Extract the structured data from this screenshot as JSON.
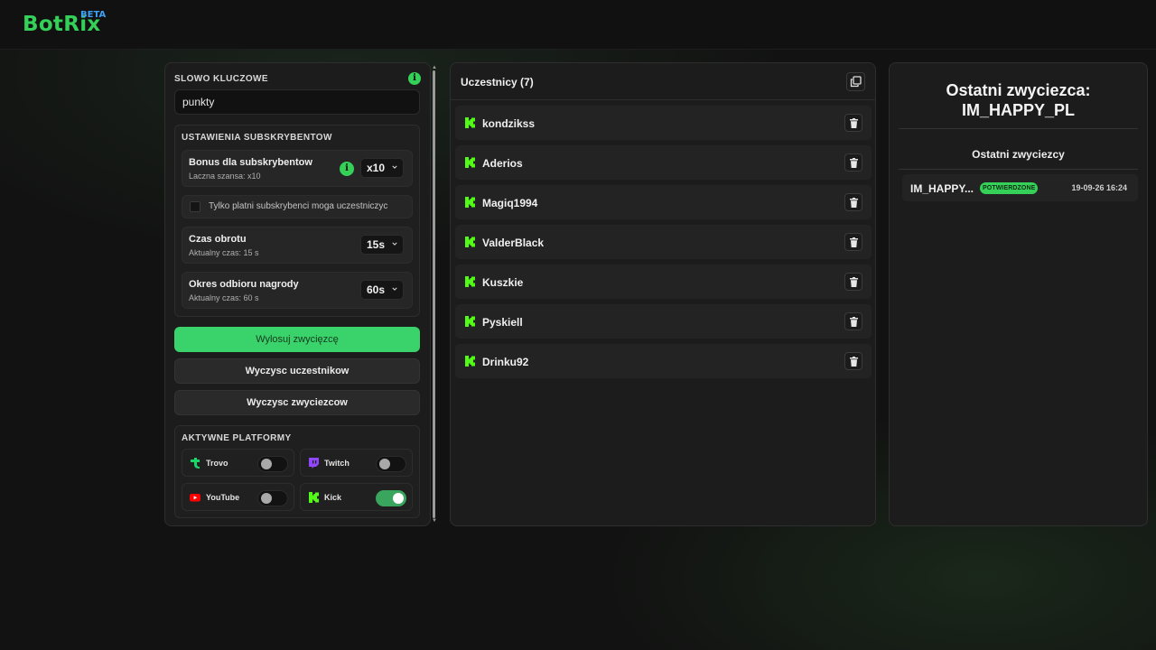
{
  "brand": {
    "name": "BotRix",
    "badge": "BETA"
  },
  "settings": {
    "keyword_label": "SLOWO KLUCZOWE",
    "keyword_value": "punkty",
    "info_glyph": "i",
    "subscriber_section_label": "USTAWIENIA SUBSKRYBENTOW",
    "bonus": {
      "title": "Bonus dla subskrybentow",
      "subtitle": "Laczna szansa: x10",
      "value": "x10"
    },
    "paid_only_label": "Tylko platni subskrybenci moga uczestniczyc",
    "paid_only_checked": false,
    "spin_time": {
      "title": "Czas obrotu",
      "subtitle": "Aktualny czas: 15 s",
      "value": "15s"
    },
    "claim_period": {
      "title": "Okres odbioru nagrody",
      "subtitle": "Aktualny czas: 60 s",
      "value": "60s"
    }
  },
  "actions": {
    "draw_winner": "Wylosuj zwycięzcę",
    "clear_participants": "Wyczysc uczestnikow",
    "clear_winners": "Wyczysc zwyciezcow"
  },
  "platforms": {
    "label": "AKTYWNE PLATFORMY",
    "items": [
      {
        "name": "Trovo",
        "enabled": false,
        "icon": "trovo-icon",
        "color": "#19d66b"
      },
      {
        "name": "Twitch",
        "enabled": false,
        "icon": "twitch-icon",
        "color": "#9146ff"
      },
      {
        "name": "YouTube",
        "enabled": false,
        "icon": "youtube-icon",
        "color": "#ff0000"
      },
      {
        "name": "Kick",
        "enabled": true,
        "icon": "kick-icon",
        "color": "#53fc18"
      }
    ]
  },
  "participants": {
    "title": "Uczestnicy (7)",
    "items": [
      "kondzikss",
      "Aderios",
      "Magiq1994",
      "ValderBlack",
      "Kuszkie",
      "Pyskiell",
      "Drinku92"
    ]
  },
  "winners": {
    "last_winner_title": "Ostatni zwyciezca:",
    "last_winner_name": "IM_HAPPY_PL",
    "recent_title": "Ostatni zwyciezcy",
    "rows": [
      {
        "name": "IM_HAPPY...",
        "status": "POTWIERDZONE",
        "date": "19-09-26 16:24"
      }
    ]
  },
  "colors": {
    "accent": "#34d058",
    "beta": "#3fa1f5",
    "kick": "#53fc18",
    "background": "#121212",
    "panel": "#1c1c1c"
  }
}
